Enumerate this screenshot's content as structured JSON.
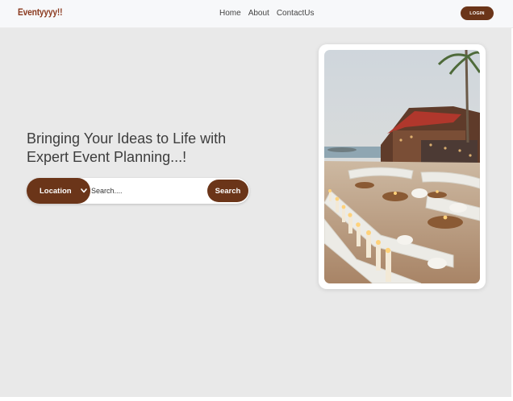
{
  "navbar": {
    "brand": "Eventyyyy!!",
    "links": [
      "Home",
      "About",
      "ContactUs"
    ],
    "login_label": "LOGIN"
  },
  "hero": {
    "headline_line1": "Bringing Your Ideas to Life with",
    "headline_line2": "Expert Event Planning...!",
    "search": {
      "location_label": "Location",
      "placeholder": "Search....",
      "button_label": "Search"
    },
    "image": {
      "alt": "Outdoor seaside event venue with candle-lit lounge seating"
    }
  },
  "colors": {
    "brand": "#8b3a1f",
    "accent": "#6b3519",
    "hero_bg": "#e9e9e9",
    "navbar_bg": "#f7f8fa"
  },
  "icons": {
    "location_dropdown": "chevron-down-icon"
  }
}
